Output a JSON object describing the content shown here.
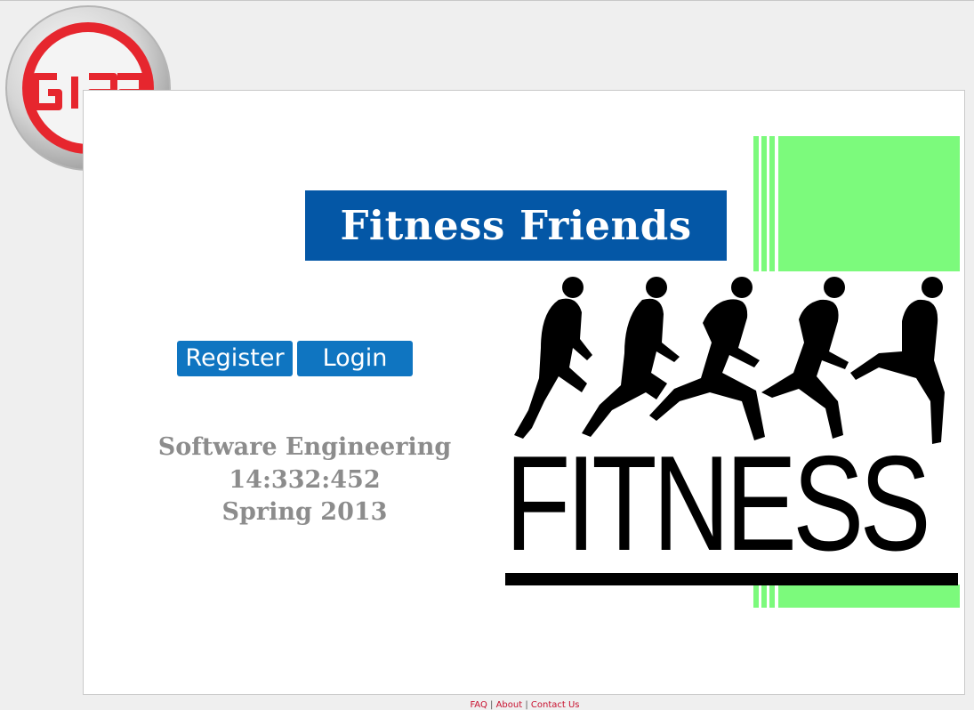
{
  "header": {
    "logo_icon": "g12-logo-icon"
  },
  "hero": {
    "title": "Fitness Friends",
    "title_bg_color": "#0457a6",
    "image_icon": "fitness-runners-icon",
    "image_word": "FITNESS",
    "accent_color": "#7cfa7c"
  },
  "actions": {
    "register_label": "Register",
    "login_label": "Login",
    "button_color": "#0f75c1"
  },
  "course": {
    "name": "Software Engineering",
    "code": "14:332:452",
    "term": "Spring 2013"
  },
  "footer": {
    "faq": "FAQ",
    "about": "About",
    "contact": "Contact Us",
    "separator": "|"
  }
}
